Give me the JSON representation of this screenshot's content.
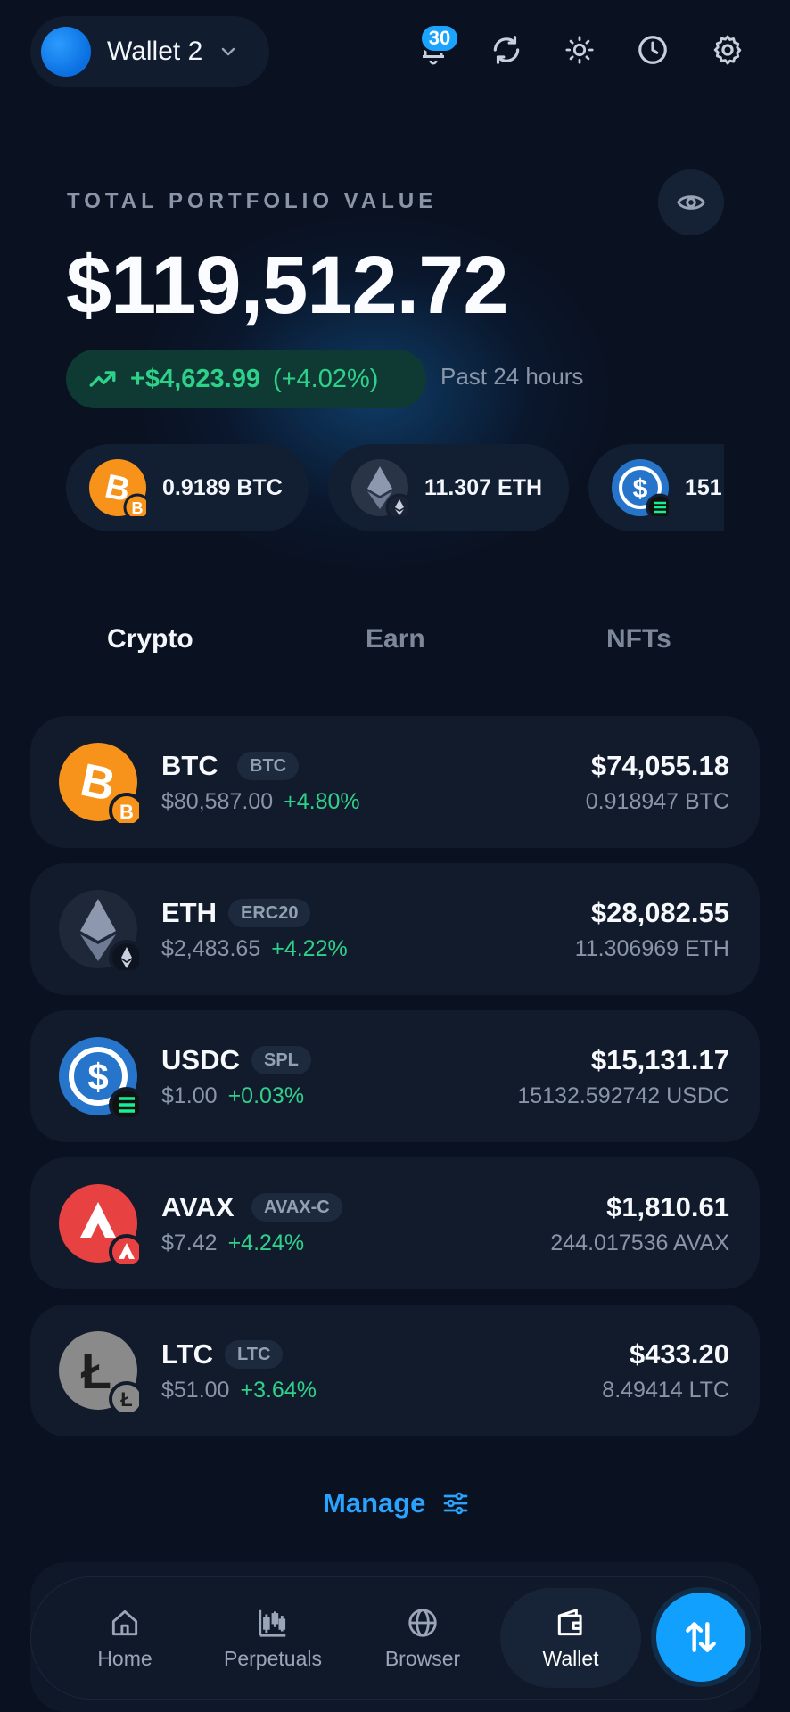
{
  "header": {
    "wallet_name": "Wallet 2",
    "notification_count": "30",
    "icons": [
      "bell-icon",
      "refresh-icon",
      "sun-icon",
      "clock-icon",
      "gear-icon"
    ]
  },
  "portfolio": {
    "label": "TOTAL PORTFOLIO VALUE",
    "total": "$119,512.72",
    "change_amount": "+$4,623.99",
    "change_percent": "(+4.02%)",
    "period": "Past 24 hours"
  },
  "coin_strip": [
    {
      "amount": "0.9189 BTC",
      "icon": "btc-icon"
    },
    {
      "amount": "11.307 ETH",
      "icon": "eth-icon"
    },
    {
      "amount": "151",
      "icon": "usdc-icon"
    }
  ],
  "tabs": [
    {
      "label": "Crypto",
      "active": true
    },
    {
      "label": "Earn",
      "active": false
    },
    {
      "label": "NFTs",
      "active": false
    }
  ],
  "assets": [
    {
      "name": "BTC",
      "tag": "BTC",
      "price": "$80,587.00",
      "change": "+4.80%",
      "value": "$74,055.18",
      "qty": "0.918947 BTC"
    },
    {
      "name": "ETH",
      "tag": "ERC20",
      "price": "$2,483.65",
      "change": "+4.22%",
      "value": "$28,082.55",
      "qty": "11.306969 ETH"
    },
    {
      "name": "USDC",
      "tag": "SPL",
      "price": "$1.00",
      "change": "+0.03%",
      "value": "$15,131.17",
      "qty": "15132.592742 USDC"
    },
    {
      "name": "AVAX",
      "tag": "AVAX-C",
      "price": "$7.42",
      "change": "+4.24%",
      "value": "$1,810.61",
      "qty": "244.017536 AVAX"
    },
    {
      "name": "LTC",
      "tag": "LTC",
      "price": "$51.00",
      "change": "+3.64%",
      "value": "$433.20",
      "qty": "8.49414 LTC"
    }
  ],
  "manage_label": "Manage",
  "nav": [
    {
      "label": "Home",
      "icon": "home-icon"
    },
    {
      "label": "Perpetuals",
      "icon": "candlestick-icon"
    },
    {
      "label": "Browser",
      "icon": "globe-icon"
    },
    {
      "label": "Wallet",
      "icon": "wallet-icon"
    }
  ],
  "colors": {
    "background": "#0a1120",
    "accent": "#1aa3ff",
    "positive": "#2ed18a",
    "card": "#111b2c",
    "muted": "#8a96a8"
  }
}
